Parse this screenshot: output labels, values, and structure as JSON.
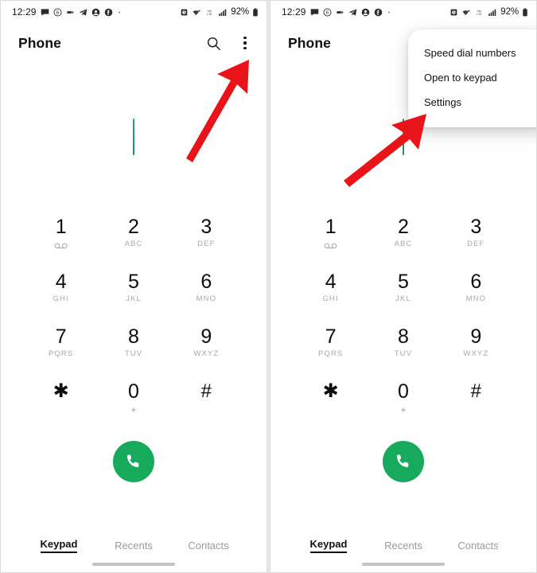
{
  "status_bar": {
    "time": "12:29",
    "battery_text": "92%",
    "left_icons": [
      "chat-bubble-icon",
      "circled-b-icon",
      "bookmark-icon",
      "telegram-icon",
      "dark-circle-icon",
      "facebook-icon",
      "more-dot-icon"
    ],
    "right_icons": [
      "alarm-icon",
      "wifi-icon",
      "volte-icon",
      "signal-bars-icon",
      "battery-icon"
    ],
    "volte_label": "VoLTE"
  },
  "app_bar": {
    "title": "Phone",
    "search_icon": "search-icon",
    "overflow_icon": "three-dot-menu-icon"
  },
  "keypad": {
    "keys": [
      {
        "num": "1",
        "sub": "",
        "voicemail": true
      },
      {
        "num": "2",
        "sub": "ABC",
        "voicemail": false
      },
      {
        "num": "3",
        "sub": "DEF",
        "voicemail": false
      },
      {
        "num": "4",
        "sub": "GHI",
        "voicemail": false
      },
      {
        "num": "5",
        "sub": "JKL",
        "voicemail": false
      },
      {
        "num": "6",
        "sub": "MNO",
        "voicemail": false
      },
      {
        "num": "7",
        "sub": "PQRS",
        "voicemail": false
      },
      {
        "num": "8",
        "sub": "TUV",
        "voicemail": false
      },
      {
        "num": "9",
        "sub": "WXYZ",
        "voicemail": false
      },
      {
        "num": "✱",
        "sub": "",
        "voicemail": false
      },
      {
        "num": "0",
        "sub": "+",
        "voicemail": false
      },
      {
        "num": "#",
        "sub": "",
        "voicemail": false
      }
    ],
    "call_button_icon": "phone-handset-icon",
    "call_button_color": "#17a95c",
    "cursor_color": "#1f8f6c"
  },
  "tabs": [
    {
      "label": "Keypad",
      "active": true
    },
    {
      "label": "Recents",
      "active": false
    },
    {
      "label": "Contacts",
      "active": false
    }
  ],
  "overflow_menu": {
    "items": [
      {
        "label": "Speed dial numbers"
      },
      {
        "label": "Open to keypad"
      },
      {
        "label": "Settings"
      }
    ]
  },
  "annotations": {
    "arrow_color": "#e8141a",
    "left_arrow_target": "three-dot-menu-icon",
    "right_arrow_target": "Settings"
  }
}
